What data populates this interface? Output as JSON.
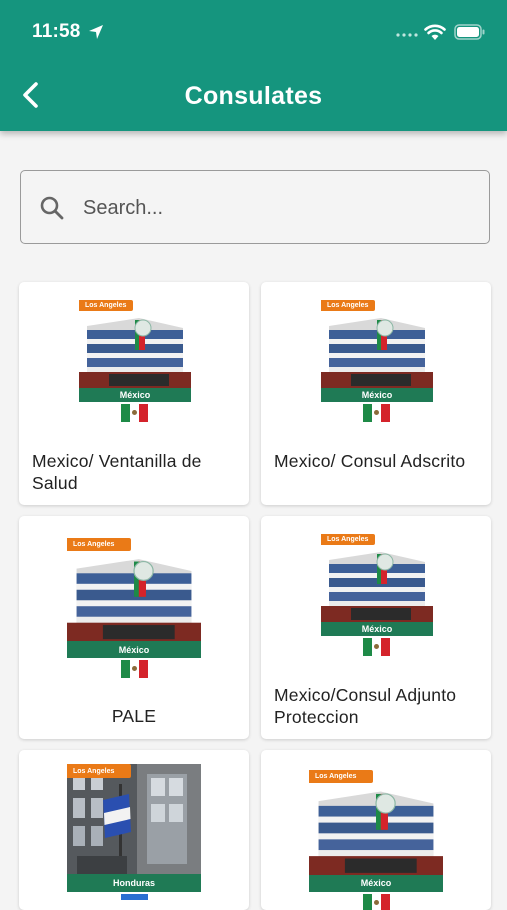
{
  "status_bar": {
    "time": "11:58"
  },
  "header": {
    "title": "Consulates"
  },
  "search": {
    "placeholder": "Search..."
  },
  "cards": [
    {
      "label": "Mexico/ Ventanilla de Salud",
      "image_tag": "Los Angeles",
      "image_banner": "México"
    },
    {
      "label": "Mexico/ Consul Adscrito",
      "image_tag": "Los Angeles",
      "image_banner": "México"
    },
    {
      "label": "PALE",
      "image_tag": "Los Angeles",
      "image_banner": "México"
    },
    {
      "label": "Mexico/Consul Adjunto Proteccion",
      "image_tag": "Los Angeles",
      "image_banner": "México"
    },
    {
      "label": "",
      "image_tag": "Los Angeles",
      "image_banner": "Honduras"
    },
    {
      "label": "",
      "image_tag": "Los Angeles",
      "image_banner": "México"
    }
  ],
  "colors": {
    "header": "#15957e",
    "banner": "#1f7a55",
    "tag": "#ea7a17",
    "background": "#f4f4f4"
  }
}
